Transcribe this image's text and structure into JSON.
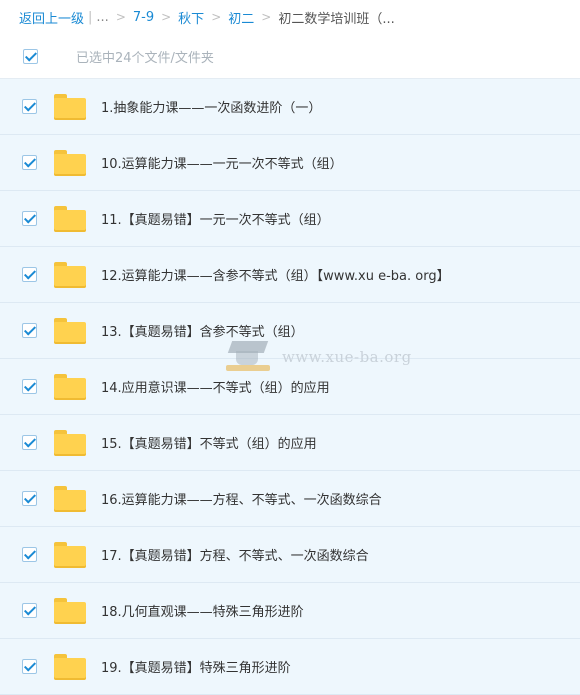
{
  "breadcrumb": {
    "back_label": "返回上一级",
    "pipe": "|",
    "ellipsis": "...",
    "separator": ">",
    "crumbs": [
      "7-9",
      "秋下",
      "初二"
    ],
    "current": "初二数学培训班（..."
  },
  "selection": {
    "checked": true,
    "label": "已选中24个文件/文件夹"
  },
  "files": [
    {
      "name": "1.抽象能力课——一次函数进阶（一）",
      "checked": true,
      "type": "folder"
    },
    {
      "name": "10.运算能力课——一元一次不等式（组）",
      "checked": true,
      "type": "folder"
    },
    {
      "name": "11.【真题易错】一元一次不等式（组）",
      "checked": true,
      "type": "folder"
    },
    {
      "name": "12.运算能力课——含参不等式（组）【www.xu e-ba. org】",
      "checked": true,
      "type": "folder"
    },
    {
      "name": "13.【真题易错】含参不等式（组）",
      "checked": true,
      "type": "folder"
    },
    {
      "name": "14.应用意识课——不等式（组）的应用",
      "checked": true,
      "type": "folder"
    },
    {
      "name": "15.【真题易错】不等式（组）的应用",
      "checked": true,
      "type": "folder"
    },
    {
      "name": "16.运算能力课——方程、不等式、一次函数综合",
      "checked": true,
      "type": "folder"
    },
    {
      "name": "17.【真题易错】方程、不等式、一次函数综合",
      "checked": true,
      "type": "folder"
    },
    {
      "name": "18.几何直观课——特殊三角形进阶",
      "checked": true,
      "type": "folder"
    },
    {
      "name": "19.【真题易错】特殊三角形进阶",
      "checked": true,
      "type": "folder"
    }
  ],
  "watermark": {
    "text": "www.xue-ba.org"
  },
  "colors": {
    "accent": "#1a8ad4",
    "row_background": "#eef7fd",
    "folder": "#ffd24f"
  },
  "icons": {
    "checkbox": "checkbox-checked-icon",
    "folder": "folder-icon"
  }
}
